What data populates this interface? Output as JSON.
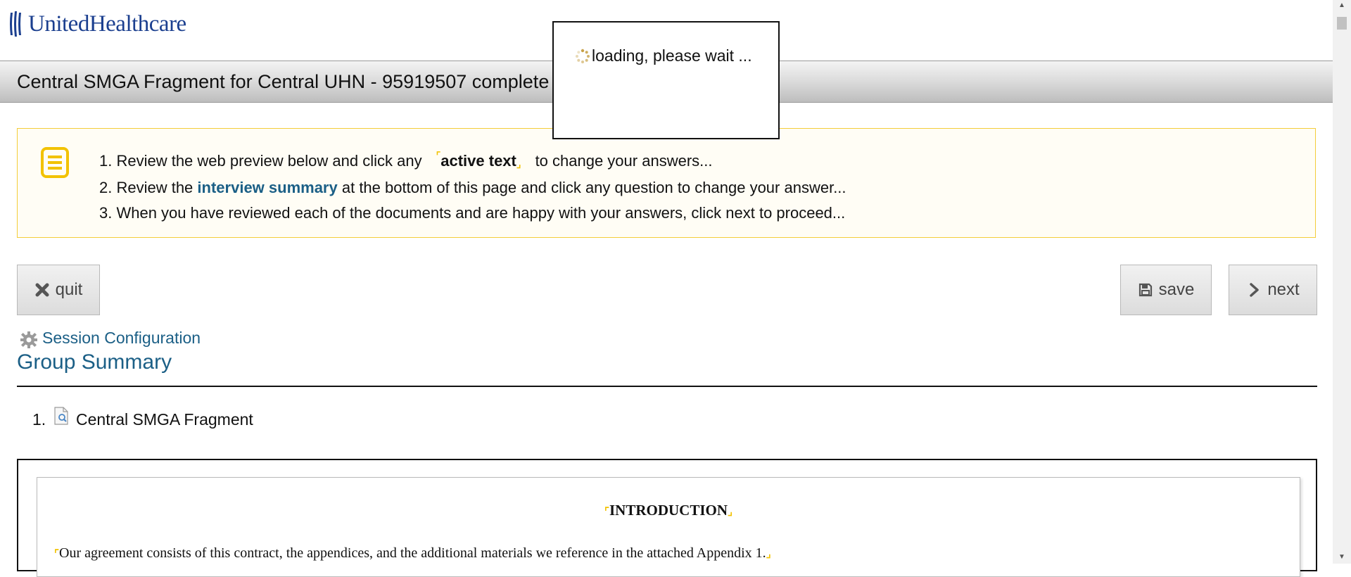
{
  "brand": {
    "name": "UnitedHealthcare",
    "color": "#1b3f8f"
  },
  "title_bar": {
    "text": "Central SMGA Fragment for Central UHN - 95919507 complete"
  },
  "loading": {
    "text": "loading, please wait ...",
    "icon": "spinner-icon"
  },
  "instructions": {
    "icon": "document-list-icon",
    "item1_prefix": "1. Review the web preview below and click any",
    "item1_active": "active text",
    "item1_suffix": "to change your answers...",
    "item2_prefix": "2. Review the",
    "item2_link": "interview summary",
    "item2_suffix": "at the bottom of this page and click any question to change your answer...",
    "item3": "3. When you have reviewed each of the documents and are happy with your answers, click next to proceed..."
  },
  "toolbar": {
    "quit_label": "quit",
    "save_label": "save",
    "next_label": "next"
  },
  "session": {
    "label": "Session Configuration",
    "icon": "gear-icon"
  },
  "group_summary": {
    "heading": "Group Summary",
    "items": [
      {
        "number": "1.",
        "label": "Central SMGA Fragment",
        "icon": "document-preview-icon"
      }
    ]
  },
  "document": {
    "heading": "INTRODUCTION",
    "paragraph": "Our agreement consists of this contract, the appendices, and the additional materials we reference in the attached Appendix 1."
  },
  "colors": {
    "accent": "#1b5f86",
    "highlight": "#f2c200",
    "notice_bg": "#fffdf5",
    "notice_border": "#f3cd3a"
  }
}
